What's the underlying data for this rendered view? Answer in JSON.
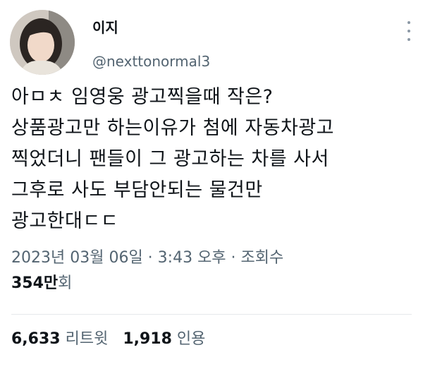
{
  "author": {
    "display_name": "이지",
    "handle": "@nexttonormal3",
    "avatar_icon": "profile-photo"
  },
  "tweet": {
    "lines": [
      "아ㅁㅊ 임영웅 광고찍을때 작은?",
      "상품광고만 하는이유가 첨에 자동차광고",
      "찍었더니 팬들이 그 광고하는 차를 사서",
      "그후로 사도 부담안되는 물건만",
      "광고한대ㄷㄷ"
    ]
  },
  "meta": {
    "date": "2023년 03월 06일",
    "sep1": " · ",
    "time": "3:43 오후",
    "sep2": " · ",
    "views_label": "조회수",
    "views_count": "354만",
    "views_suffix": "회"
  },
  "stats": {
    "retweets_count": "6,633",
    "retweets_label": "리트윗",
    "quotes_count": "1,918",
    "quotes_label": "인용"
  }
}
